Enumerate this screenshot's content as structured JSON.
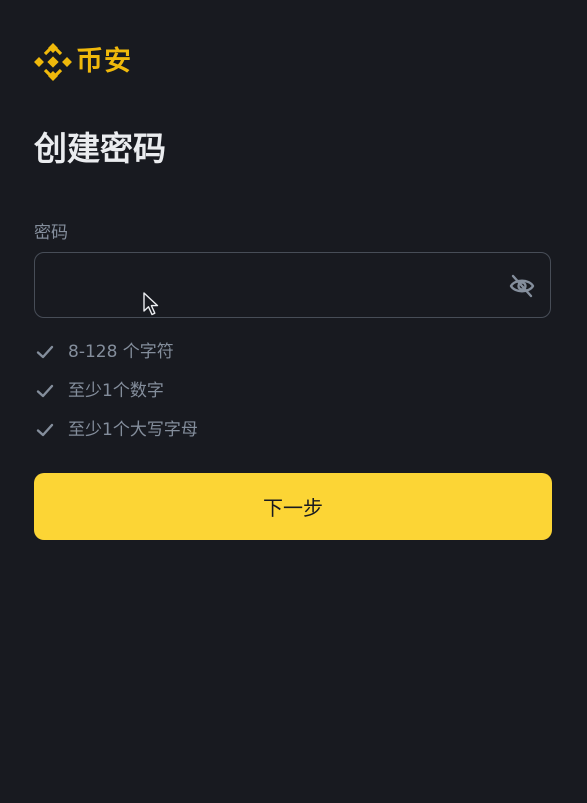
{
  "brand": {
    "name": "币安",
    "logo_icon": "binance-logo-icon",
    "accent_color": "#F0B90B"
  },
  "page": {
    "title": "创建密码"
  },
  "password_field": {
    "label": "密码",
    "value": "",
    "placeholder": "",
    "visibility_icon": "eye-off-icon"
  },
  "requirements": [
    {
      "text": "8-128 个字符",
      "icon": "check-icon"
    },
    {
      "text": "至少1个数字",
      "icon": "check-icon"
    },
    {
      "text": "至少1个大写字母",
      "icon": "check-icon"
    }
  ],
  "next_button": {
    "label": "下一步",
    "color": "#FCD535"
  },
  "colors": {
    "background": "#181A20",
    "muted_text": "#848E9C",
    "border": "#474D57"
  }
}
